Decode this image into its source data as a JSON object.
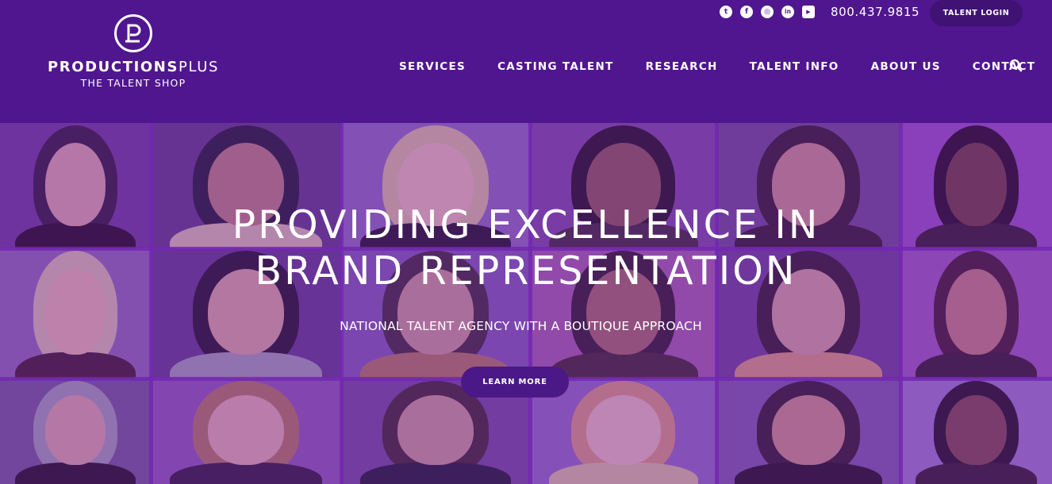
{
  "brand": {
    "name_bold": "PRODUCTIONS",
    "name_light": "PLUS",
    "subtitle": "THE TALENT SHOP"
  },
  "topbar": {
    "social_icons": [
      "twitter-icon",
      "facebook-icon",
      "instagram-icon",
      "linkedin-icon",
      "youtube-icon"
    ],
    "social_glyphs": [
      "t",
      "f",
      "◎",
      "in",
      "▶"
    ],
    "phone": "800.437.9815",
    "login_label": "TALENT LOGIN"
  },
  "nav": {
    "items": [
      "SERVICES",
      "CASTING TALENT",
      "RESEARCH",
      "TALENT INFO",
      "ABOUT US",
      "CONTACT"
    ],
    "search_icon": "search-icon"
  },
  "hero": {
    "headline_line1": "PROVIDING EXCELLENCE IN",
    "headline_line2": "BRAND REPRESENTATION",
    "tagline": "NATIONAL TALENT AGENCY WITH A BOUTIQUE APPROACH",
    "cta_label": "LEARN MORE"
  },
  "colors": {
    "header_bg": "#50168f",
    "overlay": "#7828be",
    "button_bg": "#4a1887"
  }
}
